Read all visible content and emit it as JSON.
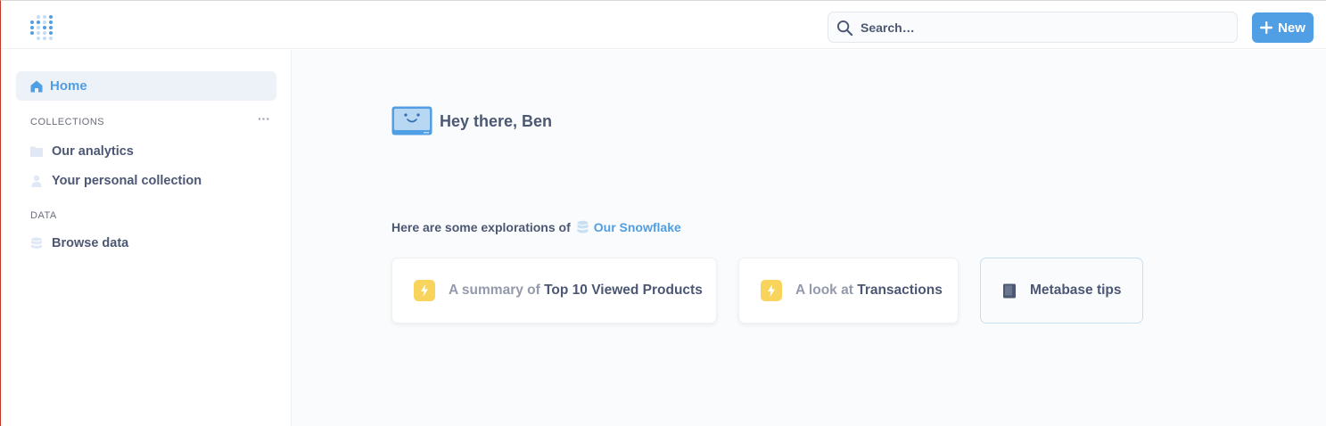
{
  "app": {
    "accent_color": "#509ee3",
    "logo_icon": "metabase-logo-icon"
  },
  "header": {
    "search_placeholder": "Search…",
    "new_button_label": "New"
  },
  "sidebar": {
    "home_label": "Home",
    "collections_heading": "COLLECTIONS",
    "collections_more": "···",
    "collections": [
      {
        "label": "Our analytics",
        "icon": "folder-icon"
      },
      {
        "label": "Your personal collection",
        "icon": "person-icon"
      }
    ],
    "data_heading": "DATA",
    "browse_data_label": "Browse data"
  },
  "main": {
    "greeting": "Hey there, Ben",
    "explorations_prefix": "Here are some explorations of",
    "database_name": "Our Snowflake",
    "cards": [
      {
        "prefix": "A summary of",
        "title": "Top 10 Viewed Products",
        "icon": "bolt-icon"
      },
      {
        "prefix": "A look at",
        "title": "Transactions",
        "icon": "bolt-icon"
      }
    ],
    "tips_card_label": "Metabase tips"
  }
}
